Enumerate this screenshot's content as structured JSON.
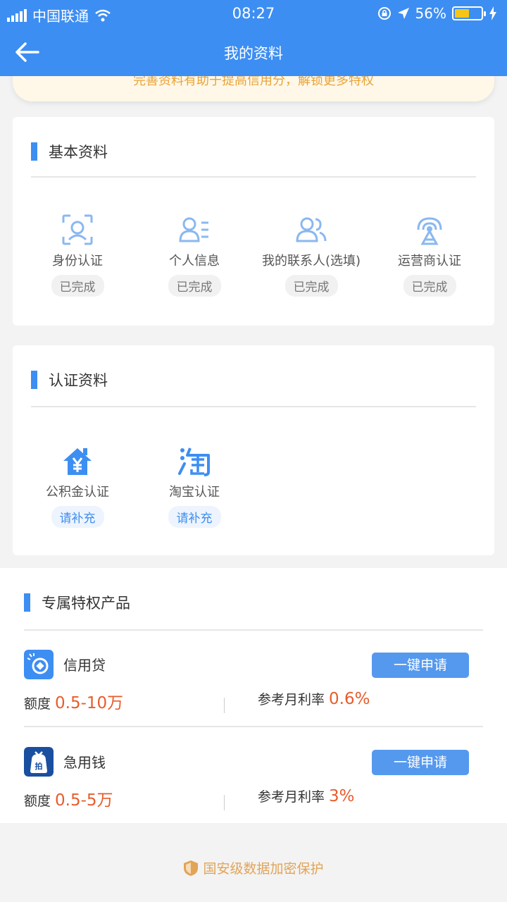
{
  "status": {
    "carrier": "中国联通",
    "time": "08:27",
    "battery": "56%",
    "battery_level": 0.56
  },
  "nav": {
    "title": "我的资料"
  },
  "banner": {
    "text": "完善资料有助于提高信用分，解锁更多特权"
  },
  "basic": {
    "title": "基本资料",
    "items": [
      {
        "name": "身份认证",
        "status": "已完成",
        "icon": "face-scan-icon"
      },
      {
        "name": "个人信息",
        "status": "已完成",
        "icon": "person-info-icon"
      },
      {
        "name": "我的联系人(选填)",
        "status": "已完成",
        "icon": "contacts-icon"
      },
      {
        "name": "运营商认证",
        "status": "已完成",
        "icon": "signal-tower-icon"
      }
    ]
  },
  "cert": {
    "title": "认证资料",
    "items": [
      {
        "name": "公积金认证",
        "status": "请补充",
        "icon": "house-yuan-icon"
      },
      {
        "name": "淘宝认证",
        "status": "请补充",
        "icon": "taobao-icon"
      }
    ]
  },
  "products": {
    "title": "专属特权产品",
    "items": [
      {
        "name": "信用贷",
        "button": "一键申请",
        "amount_label": "额度",
        "amount": "0.5-10万",
        "rate_label": "参考月利率",
        "rate": "0.6%"
      },
      {
        "name": "急用钱",
        "button": "一键申请",
        "amount_label": "额度",
        "amount": "0.5-5万",
        "rate_label": "参考月利率",
        "rate": "3%"
      }
    ]
  },
  "footer": {
    "text": "国安级数据加密保护"
  },
  "colors": {
    "primary": "#3d8ef2",
    "accent": "#e85c2b",
    "banner_text": "#e8a33a"
  }
}
